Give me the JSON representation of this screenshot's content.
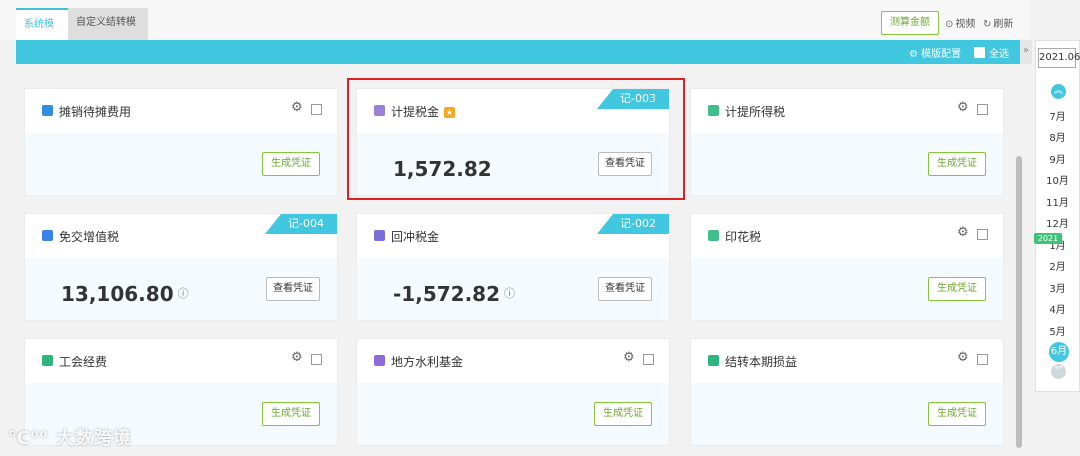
{
  "tabs": [
    {
      "label": "系统模板",
      "active": true
    },
    {
      "label": "自定义结转模版",
      "active": false
    }
  ],
  "toolbar": {
    "calc_label": "测算金额",
    "video_label": "视频",
    "refresh_label": "刷新",
    "template_config_label": "模版配置",
    "select_all_label": "全选",
    "collapse_glyph": "»"
  },
  "cards": [
    {
      "title": "摊销待摊费用",
      "icon": "grid-icon",
      "icon_color": "#2f8ee0",
      "state": "generate",
      "button": "生成凭证"
    },
    {
      "title": "计提税金",
      "icon": "stack-icon",
      "icon_color": "#9c7fd8",
      "state": "view",
      "amount": "1,572.82",
      "badge": "记-003",
      "button": "查看凭证",
      "starred": true
    },
    {
      "title": "计提所得税",
      "icon": "stack-icon",
      "icon_color": "#3fbf8a",
      "state": "generate",
      "button": "生成凭证"
    },
    {
      "title": "免交增值税",
      "icon": "leaf-icon",
      "icon_color": "#3b82e6",
      "state": "view",
      "amount": "13,106.80",
      "badge": "记-004",
      "button": "查看凭证",
      "help": true
    },
    {
      "title": "回冲税金",
      "icon": "ticket-icon",
      "icon_color": "#7b6ed6",
      "state": "view",
      "amount": "-1,572.82",
      "badge": "记-002",
      "button": "查看凭证",
      "help": true
    },
    {
      "title": "印花税",
      "icon": "stamp-icon",
      "icon_color": "#3fbf8a",
      "state": "generate",
      "button": "生成凭证"
    },
    {
      "title": "工会经费",
      "icon": "house-icon",
      "icon_color": "#2cb67d",
      "state": "generate",
      "button": "生成凭证"
    },
    {
      "title": "地方水利基金",
      "icon": "book-icon",
      "icon_color": "#8e6ad8",
      "state": "generate",
      "button": "生成凭证"
    },
    {
      "title": "结转本期损益",
      "icon": "bag-icon",
      "icon_color": "#2cb67d",
      "state": "generate",
      "button": "生成凭证"
    }
  ],
  "calendar": {
    "year": "2021.06",
    "year_marker": "2021",
    "months": [
      "7月",
      "8月",
      "9月",
      "10月",
      "11月",
      "12月",
      "1月",
      "2月",
      "3月",
      "4月",
      "5月",
      "6月"
    ],
    "current": "6月"
  },
  "watermark": "大数跨境",
  "colors": {
    "accent": "#41c7df",
    "green": "#86c63a",
    "highlight": "#e02020"
  }
}
